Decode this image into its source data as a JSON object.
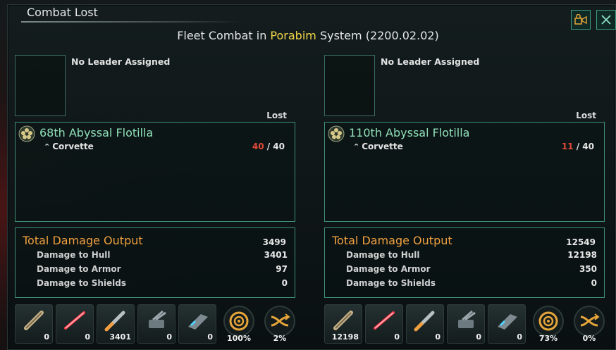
{
  "window": {
    "title": "Combat Lost"
  },
  "header": {
    "prefix": "Fleet Combat in ",
    "system": "Porabim",
    "suffix": " System (2200.02.02)"
  },
  "colors": {
    "accent": "#3e8f78",
    "system": "#f0d64a",
    "loss": "#e04a38",
    "damage_title": "#f0a040",
    "fleet_name": "#8fe0b8"
  },
  "sides": [
    {
      "leader": "No Leader Assigned",
      "lost_header": "Lost",
      "fleet_name": "68th Abyssal Flotilla",
      "ship_class": "Corvette",
      "ships_lost": "40",
      "ships_total": "/ 40",
      "damage": {
        "title": "Total Damage Output",
        "total": "3499",
        "rows": [
          {
            "label": "Damage to Hull",
            "value": "3401"
          },
          {
            "label": "Damage to Armor",
            "value": "97"
          },
          {
            "label": "Damage to Shields",
            "value": "0"
          }
        ]
      },
      "weapons": [
        {
          "icon": "mass-driver-icon",
          "value": "0"
        },
        {
          "icon": "red-laser-icon",
          "value": "0"
        },
        {
          "icon": "missile-icon",
          "value": "3401"
        },
        {
          "icon": "point-defense-turret-icon",
          "value": "0"
        },
        {
          "icon": "strike-craft-icon",
          "value": "0"
        }
      ],
      "stats": [
        {
          "icon": "target-hit-chance-icon",
          "value": "100%"
        },
        {
          "icon": "evasion-icon",
          "value": "2%"
        }
      ]
    },
    {
      "leader": "No Leader Assigned",
      "lost_header": "Lost",
      "fleet_name": "110th Abyssal Flotilla",
      "ship_class": "Corvette",
      "ships_lost": "11",
      "ships_total": "/ 40",
      "damage": {
        "title": "Total Damage Output",
        "total": "12549",
        "rows": [
          {
            "label": "Damage to Hull",
            "value": "12198"
          },
          {
            "label": "Damage to Armor",
            "value": "350"
          },
          {
            "label": "Damage to Shields",
            "value": "0"
          }
        ]
      },
      "weapons": [
        {
          "icon": "mass-driver-icon",
          "value": "12198"
        },
        {
          "icon": "red-laser-icon",
          "value": "0"
        },
        {
          "icon": "missile-icon",
          "value": "0"
        },
        {
          "icon": "point-defense-turret-icon",
          "value": "0"
        },
        {
          "icon": "strike-craft-icon",
          "value": "0"
        }
      ],
      "stats": [
        {
          "icon": "target-hit-chance-icon",
          "value": "73%"
        },
        {
          "icon": "evasion-icon",
          "value": "0%"
        }
      ]
    }
  ]
}
